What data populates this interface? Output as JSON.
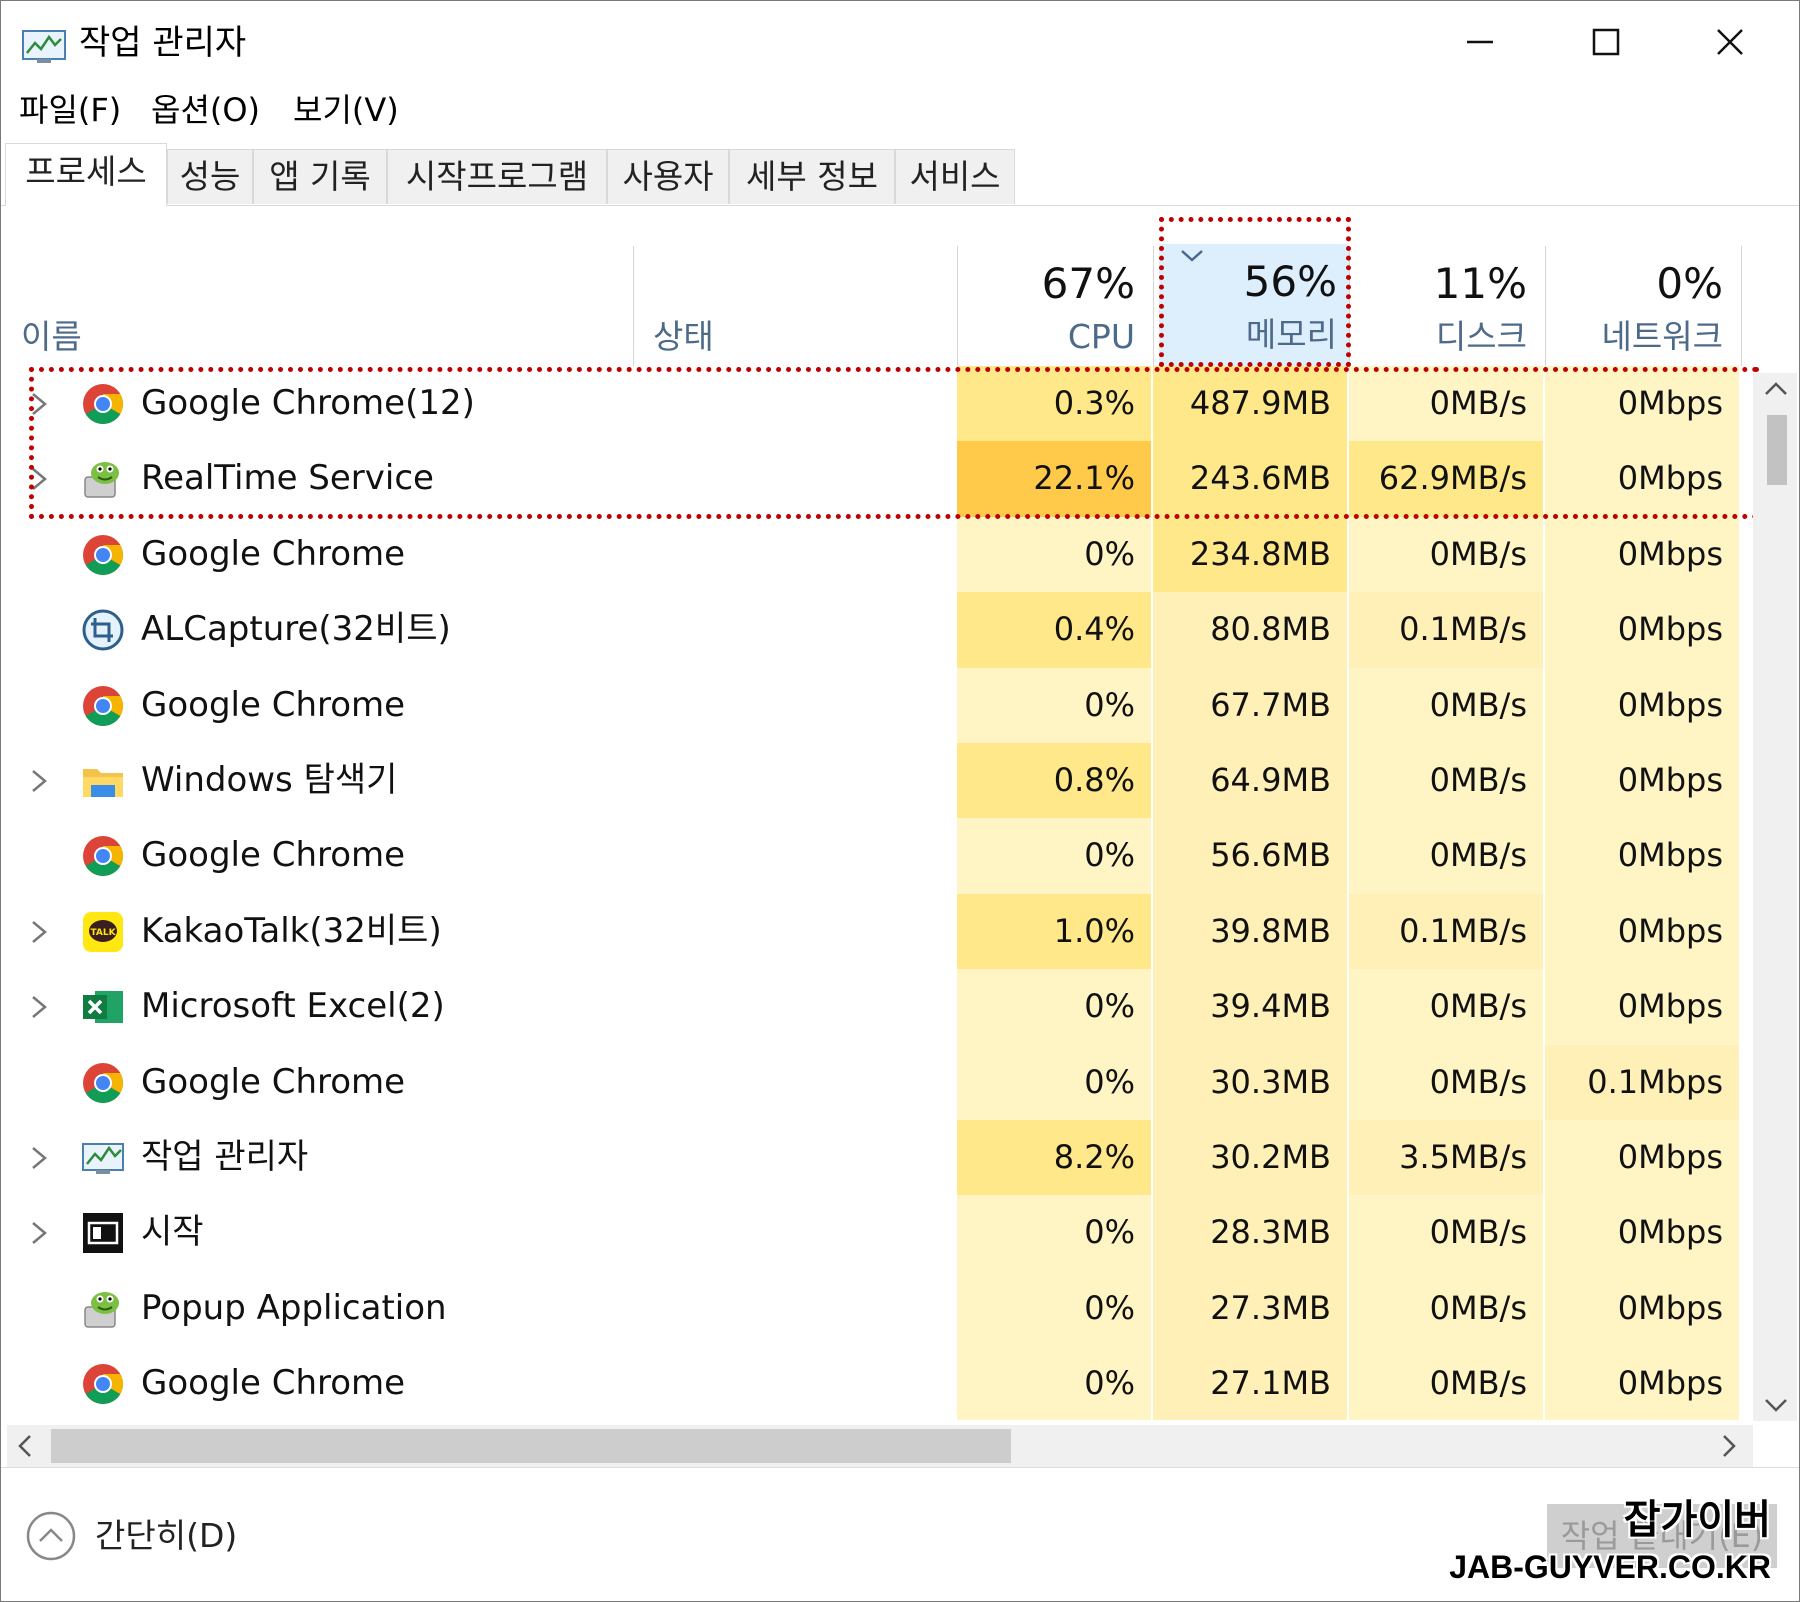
{
  "window": {
    "title": "작업 관리자",
    "controls": {
      "minimize": "minimize-icon",
      "maximize": "maximize-icon",
      "close": "close-icon"
    }
  },
  "menu": [
    {
      "label": "파일(F)"
    },
    {
      "label": "옵션(O)"
    },
    {
      "label": "보기(V)"
    }
  ],
  "tabs": [
    {
      "label": "프로세스",
      "active": true
    },
    {
      "label": "성능"
    },
    {
      "label": "앱 기록"
    },
    {
      "label": "시작프로그램"
    },
    {
      "label": "사용자"
    },
    {
      "label": "세부 정보"
    },
    {
      "label": "서비스"
    }
  ],
  "columns": {
    "name": {
      "label": "이름"
    },
    "status": {
      "label": "상태"
    },
    "cpu": {
      "label": "CPU",
      "total": "67%"
    },
    "memory": {
      "label": "메모리",
      "total": "56%",
      "sorted": true
    },
    "disk": {
      "label": "디스크",
      "total": "11%"
    },
    "network": {
      "label": "네트워크",
      "total": "0%"
    }
  },
  "processes": [
    {
      "name": "Google Chrome(12)",
      "icon": "chrome-icon",
      "expandable": true,
      "cpu": "0.3%",
      "memory": "487.9MB",
      "disk": "0MB/s",
      "network": "0Mbps"
    },
    {
      "name": "RealTime Service",
      "icon": "realtime-service-icon",
      "expandable": true,
      "cpu": "22.1%",
      "memory": "243.6MB",
      "disk": "62.9MB/s",
      "network": "0Mbps"
    },
    {
      "name": "Google Chrome",
      "icon": "chrome-icon",
      "expandable": false,
      "cpu": "0%",
      "memory": "234.8MB",
      "disk": "0MB/s",
      "network": "0Mbps"
    },
    {
      "name": "ALCapture(32비트)",
      "icon": "alcapture-icon",
      "expandable": false,
      "cpu": "0.4%",
      "memory": "80.8MB",
      "disk": "0.1MB/s",
      "network": "0Mbps"
    },
    {
      "name": "Google Chrome",
      "icon": "chrome-icon",
      "expandable": false,
      "cpu": "0%",
      "memory": "67.7MB",
      "disk": "0MB/s",
      "network": "0Mbps"
    },
    {
      "name": "Windows 탐색기",
      "icon": "folder-icon",
      "expandable": true,
      "cpu": "0.8%",
      "memory": "64.9MB",
      "disk": "0MB/s",
      "network": "0Mbps"
    },
    {
      "name": "Google Chrome",
      "icon": "chrome-icon",
      "expandable": false,
      "cpu": "0%",
      "memory": "56.6MB",
      "disk": "0MB/s",
      "network": "0Mbps"
    },
    {
      "name": "KakaoTalk(32비트)",
      "icon": "kakaotalk-icon",
      "expandable": true,
      "cpu": "1.0%",
      "memory": "39.8MB",
      "disk": "0.1MB/s",
      "network": "0Mbps"
    },
    {
      "name": "Microsoft Excel(2)",
      "icon": "excel-icon",
      "expandable": true,
      "cpu": "0%",
      "memory": "39.4MB",
      "disk": "0MB/s",
      "network": "0Mbps"
    },
    {
      "name": "Google Chrome",
      "icon": "chrome-icon",
      "expandable": false,
      "cpu": "0%",
      "memory": "30.3MB",
      "disk": "0MB/s",
      "network": "0.1Mbps"
    },
    {
      "name": "작업 관리자",
      "icon": "task-manager-icon",
      "expandable": true,
      "cpu": "8.2%",
      "memory": "30.2MB",
      "disk": "3.5MB/s",
      "network": "0Mbps"
    },
    {
      "name": "시작",
      "icon": "start-icon",
      "expandable": true,
      "cpu": "0%",
      "memory": "28.3MB",
      "disk": "0MB/s",
      "network": "0Mbps"
    },
    {
      "name": "Popup Application",
      "icon": "realtime-service-icon",
      "expandable": false,
      "cpu": "0%",
      "memory": "27.3MB",
      "disk": "0MB/s",
      "network": "0Mbps"
    },
    {
      "name": "Google Chrome",
      "icon": "chrome-icon",
      "expandable": false,
      "cpu": "0%",
      "memory": "27.1MB",
      "disk": "0MB/s",
      "network": "0Mbps"
    }
  ],
  "footer": {
    "less_details": "간단히(D)",
    "end_task": "작업 끝내기(E)"
  },
  "watermark": {
    "line1": "잡가이버",
    "line2": "JAB-GUYVER.CO.KR"
  },
  "colors": {
    "heat_low": "#fff4c4",
    "heat_low_alt": "#fff0b8",
    "heat_mid": "#ffe88a",
    "heat_high": "#ffc94a",
    "sorted_header": "#ddeefc",
    "highlight_border": "#c00000"
  }
}
